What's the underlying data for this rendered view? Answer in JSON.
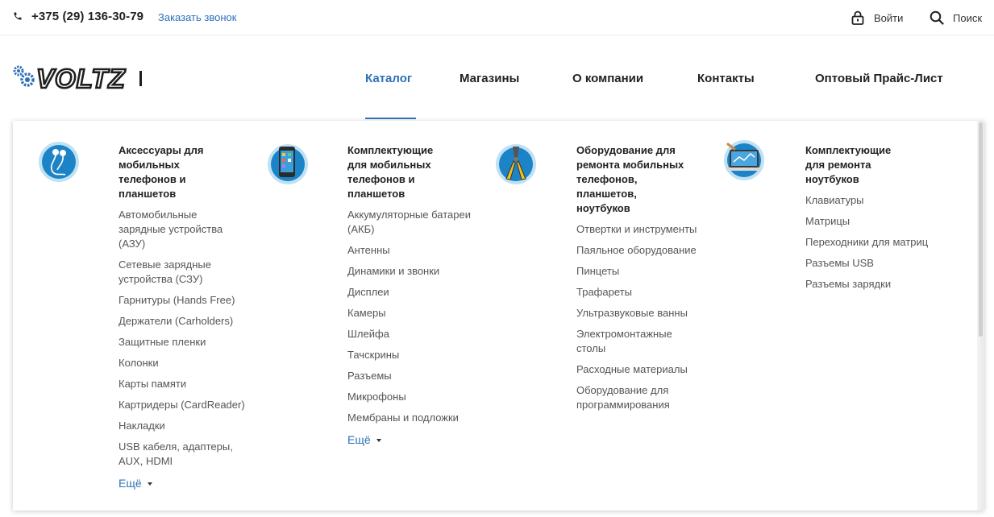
{
  "topbar": {
    "phone": "+375 (29) 136-30-79",
    "callback_label": "Заказать звонок",
    "login_label": "Войти",
    "search_label": "Поиск"
  },
  "logo": {
    "text": "VOLTZ"
  },
  "nav": {
    "items": [
      {
        "label": "Каталог"
      },
      {
        "label": "Магазины"
      },
      {
        "label": "О компании"
      },
      {
        "label": "Контакты"
      },
      {
        "label": "Оптовый Прайс-Лист"
      }
    ]
  },
  "catalog": {
    "columns": [
      {
        "title": "Аксессуары для мобильных телефонов и планшетов",
        "icon": "earphones-icon",
        "items": [
          "Автомобильные зарядные устройства (АЗУ)",
          "Сетевые зарядные устройства (СЗУ)",
          "Гарнитуры (Hands Free)",
          "Держатели (Carholders)",
          "Защитные пленки",
          "Колонки",
          "Карты памяти",
          "Картридеры (CardReader)",
          "Накладки",
          "USB кабеля, адаптеры, AUX, HDMI"
        ],
        "more_label": "Ещё"
      },
      {
        "title": "Комплектующие для мобильных телефонов и планшетов",
        "icon": "smartphone-icon",
        "items": [
          "Аккумуляторные батареи (АКБ)",
          "Антенны",
          "Динамики и звонки",
          "Дисплеи",
          "Камеры",
          "Шлейфа",
          "Тачскрины",
          "Разъемы",
          "Микрофоны",
          "Мембраны и подложки"
        ],
        "more_label": "Ещё"
      },
      {
        "title": "Оборудование для ремонта мобильных телефонов, планшетов, ноутбуков",
        "icon": "pliers-icon",
        "items": [
          "Отвертки и инструменты",
          "Паяльное оборудование",
          "Пинцеты",
          "Трафареты",
          "Ультразвуковые ванны",
          "Электромонтажные столы",
          "Расходные материалы",
          "Оборудование для программирования"
        ]
      },
      {
        "title": "Комплектующие для ремонта ноутбуков",
        "icon": "laptop-icon",
        "items": [
          "Клавиатуры",
          "Матрицы",
          "Переходники для матриц",
          "Разъемы USB",
          "Разъемы зарядки"
        ]
      }
    ]
  },
  "colors": {
    "accent": "#2e70b8",
    "icon_blue": "#1c84c6"
  }
}
